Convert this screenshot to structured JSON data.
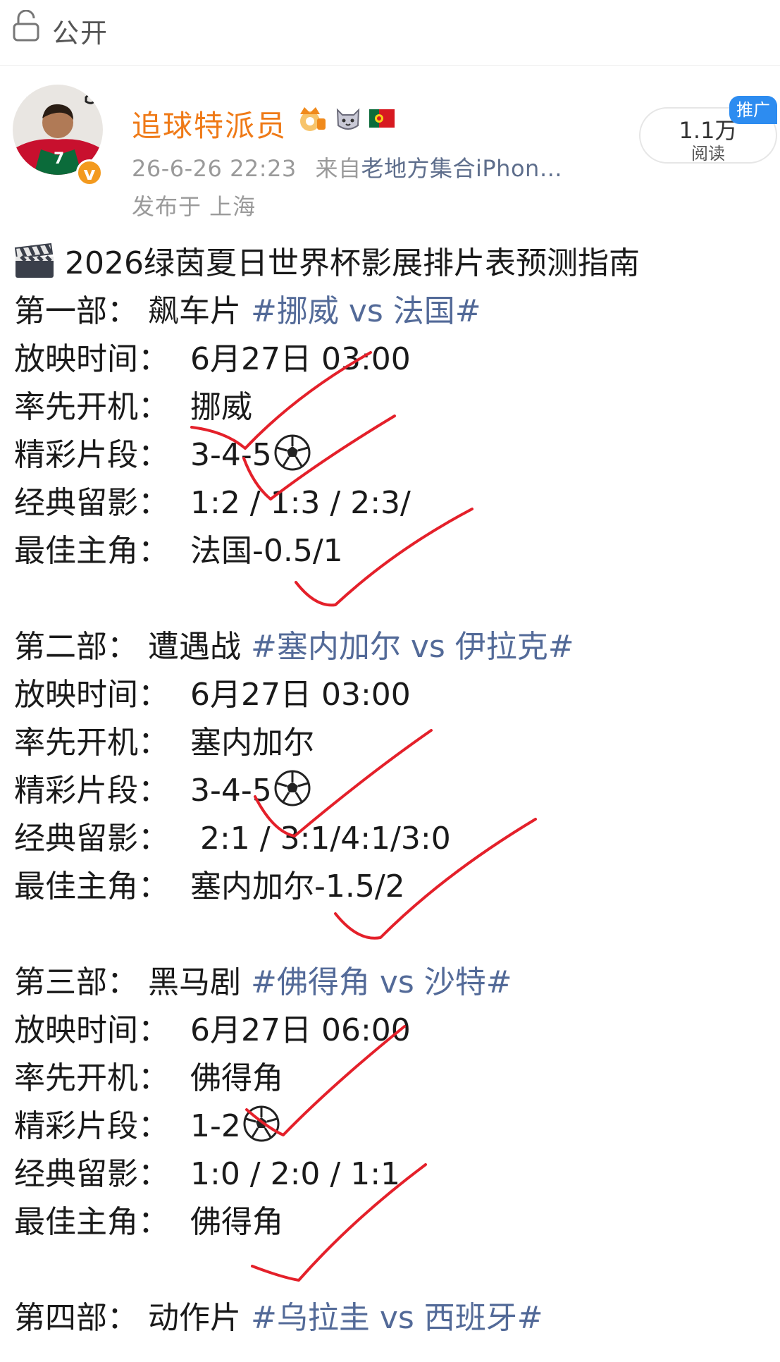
{
  "topbar": {
    "label": "公开",
    "lock_icon": "lock-open-icon"
  },
  "author": {
    "name": "追球特派员",
    "verified_badge": "v",
    "tags": [
      "crown-badge-icon",
      "cat-emoji-icon",
      "portugal-flag-icon"
    ]
  },
  "meta": {
    "time": "26-6-26 22:23",
    "source_prefix": "来自",
    "source": "老地方集合iPhon…",
    "location": "发布于 上海"
  },
  "reads": {
    "count": "1.1万",
    "label": "阅读",
    "promo": "推广"
  },
  "title": "2026绿茵夏日世界杯影展排片表预测指南",
  "title_icon": "clapper-board-icon",
  "sections": [
    {
      "header_label": "第一部：",
      "header_type": "飙车片",
      "hashtag": "#挪威 vs 法国#",
      "rows": [
        {
          "label": "放映时间：",
          "value": "6月27日 03:00"
        },
        {
          "label": "率先开机：",
          "value": "挪威"
        },
        {
          "label": "精彩片段：",
          "value": "3-4-5",
          "icon": "soccer-ball-icon"
        },
        {
          "label": "经典留影：",
          "value": "1:2 / 1:3 / 2:3/"
        },
        {
          "label": "最佳主角：",
          "value": "法国-0.5/1"
        }
      ]
    },
    {
      "header_label": "第二部：",
      "header_type": "遭遇战",
      "hashtag": "#塞内加尔 vs 伊拉克#",
      "rows": [
        {
          "label": "放映时间：",
          "value": "6月27日 03:00"
        },
        {
          "label": "率先开机：",
          "value": "塞内加尔"
        },
        {
          "label": "精彩片段：",
          "value": "3-4-5",
          "icon": "soccer-ball-icon"
        },
        {
          "label": "经典留影：",
          "value": " 2:1 / 3:1/4:1/3:0"
        },
        {
          "label": "最佳主角：",
          "value": "塞内加尔-1.5/2"
        }
      ]
    },
    {
      "header_label": "第三部：",
      "header_type": "黑马剧",
      "hashtag": "#佛得角 vs 沙特#",
      "rows": [
        {
          "label": "放映时间：",
          "value": "6月27日 06:00"
        },
        {
          "label": "率先开机：",
          "value": "佛得角"
        },
        {
          "label": "精彩片段：",
          "value": "1-2",
          "icon": "soccer-ball-icon"
        },
        {
          "label": "经典留影：",
          "value": "1:0 / 2:0 / 1:1"
        },
        {
          "label": "最佳主角：",
          "value": "佛得角"
        }
      ]
    },
    {
      "header_label": "第四部：",
      "header_type": "动作片",
      "hashtag": "#乌拉圭 vs 西班牙#",
      "rows": []
    }
  ],
  "colors": {
    "username": "#ef7a17",
    "hashtag": "#536a98",
    "meta": "#9a9a9a",
    "source": "#5e6e8c",
    "promo": "#2d8cf0",
    "check_marks": "#e4202a"
  }
}
